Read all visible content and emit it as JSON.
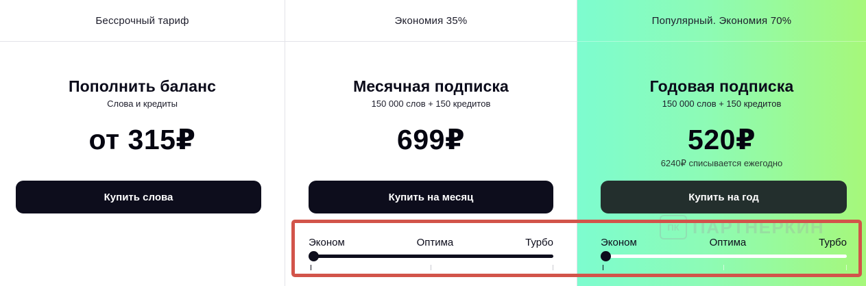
{
  "plans": [
    {
      "tag": "Бессрочный тариф",
      "title": "Пополнить баланс",
      "subtitle": "Слова и кредиты",
      "price": "от 315₽",
      "note": "",
      "button_label": "Купить слова",
      "slider": null
    },
    {
      "tag": "Экономия 35%",
      "title": "Месячная подписка",
      "subtitle": "150 000 слов + 150 кредитов",
      "price": "699₽",
      "note": "",
      "button_label": "Купить на месяц",
      "slider": {
        "labels": [
          "Эконом",
          "Оптима",
          "Турбо"
        ],
        "selected": "Эконом",
        "selected_index": 0
      }
    },
    {
      "tag": "Популярный. Экономия 70%",
      "title": "Годовая подписка",
      "subtitle": "150 000 слов + 150 кредитов",
      "price": "520₽",
      "note": "6240₽ списывается ежегодно",
      "button_label": "Купить на год",
      "slider": {
        "labels": [
          "Эконом",
          "Оптима",
          "Турбо"
        ],
        "selected": "Эконом",
        "selected_index": 0
      }
    }
  ],
  "watermark": {
    "logo_text": "ПК",
    "text": "ПАРТНЕРКИН"
  },
  "colors": {
    "highlight_accent": "#d2544a",
    "button_dark": "#0d0d1c",
    "popular_gradient_start": "#7dfccf",
    "popular_gradient_end": "#a6f87a"
  }
}
